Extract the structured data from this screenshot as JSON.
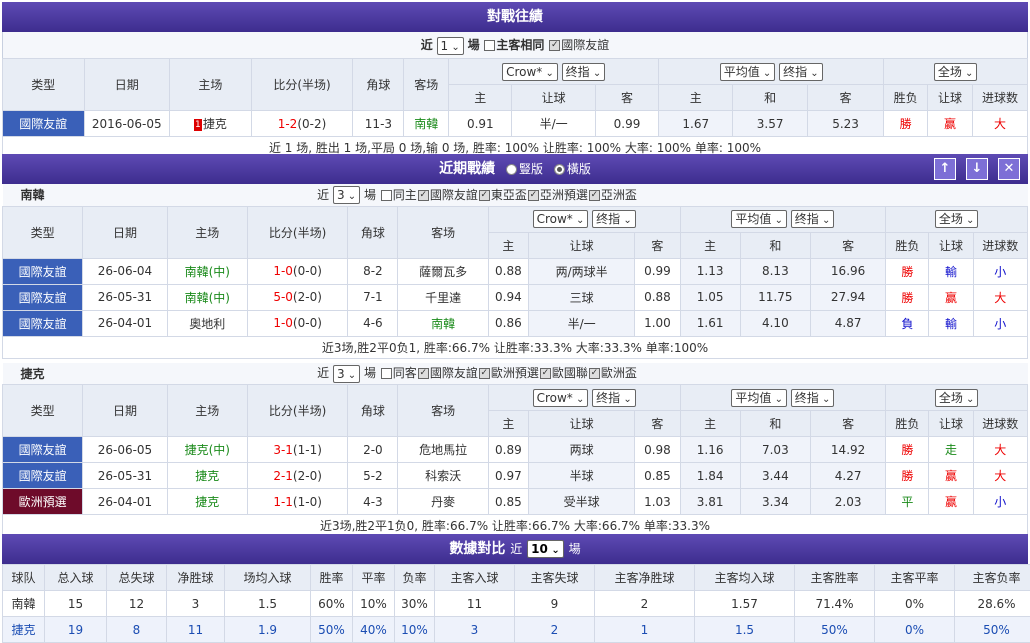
{
  "h2h": {
    "title": "對戰往績",
    "ctrl": {
      "recent": "近",
      "count": "1",
      "unit": "場",
      "same": "主客相同",
      "intl": "國際友誼"
    },
    "headers": {
      "type": "类型",
      "date": "日期",
      "home": "主场",
      "score": "比分(半场)",
      "corner": "角球",
      "away": "客场",
      "company": "Crow*",
      "handicap_sel": "终指",
      "odds_sel": "平均值",
      "odds_sel2": "终指",
      "full_sel": "全场",
      "home_h": "主",
      "line": "让球",
      "away_h": "客",
      "home_o": "主",
      "draw": "和",
      "away_o": "客",
      "result": "胜负",
      "hcres": "让球",
      "goals": "进球数"
    },
    "rows": [
      {
        "type": "國際友誼",
        "date": "2016-06-05",
        "home": "捷克",
        "home_rank": "1",
        "score": "1-2",
        "half": "(0-2)",
        "corner": "11-3",
        "away": "南韓",
        "h1": "0.91",
        "line": "半/一",
        "h2": "0.99",
        "o1": "1.67",
        "o2": "3.57",
        "o3": "5.23",
        "res": "勝",
        "hc": "赢",
        "g": "大"
      }
    ],
    "summary": "近 1 场, 胜出 1 场,平局 0 场,输 0 场, 胜率: 100% 让胜率: 100% 大率: 100% 单率: 100%"
  },
  "recent": {
    "title": "近期戰績",
    "opt1": "豎版",
    "opt2": "橫版",
    "up": "↑",
    "down": "↓",
    "close": "✕",
    "teamA": {
      "name": "南韓",
      "count": "3",
      "filters": [
        "同主",
        "國際友誼",
        "東亞盃",
        "亞洲預選",
        "亞洲盃"
      ],
      "rows": [
        {
          "type": "國際友誼",
          "date": "26-06-04",
          "home": "南韓(中)",
          "score": "1-0",
          "half": "(0-0)",
          "corner": "8-2",
          "away": "薩爾瓦多",
          "h1": "0.88",
          "line": "两/两球半",
          "h2": "0.99",
          "o1": "1.13",
          "o2": "8.13",
          "o3": "16.96",
          "res": "勝",
          "hc": "輸",
          "g": "小"
        },
        {
          "type": "國際友誼",
          "date": "26-05-31",
          "home": "南韓(中)",
          "score": "5-0",
          "half": "(2-0)",
          "corner": "7-1",
          "away": "千里達",
          "h1": "0.94",
          "line": "三球",
          "h2": "0.88",
          "o1": "1.05",
          "o2": "11.75",
          "o3": "27.94",
          "res": "勝",
          "hc": "赢",
          "g": "大"
        },
        {
          "type": "國際友誼",
          "date": "26-04-01",
          "home": "奧地利",
          "score": "1-0",
          "half": "(0-0)",
          "corner": "4-6",
          "away": "南韓",
          "h1": "0.86",
          "line": "半/一",
          "h2": "1.00",
          "o1": "1.61",
          "o2": "4.10",
          "o3": "4.87",
          "res": "負",
          "hc": "輸",
          "g": "小"
        }
      ],
      "summary": "近3场,胜2平0负1, 胜率:66.7% 让胜率:33.3% 大率:33.3% 单率:100%"
    },
    "teamB": {
      "name": "捷克",
      "count": "3",
      "filters": [
        "同客",
        "國際友誼",
        "歐洲預選",
        "歐國聯",
        "歐洲盃"
      ],
      "rows": [
        {
          "type": "國際友誼",
          "date": "26-06-05",
          "home": "捷克(中)",
          "score": "3-1",
          "half": "(1-1)",
          "corner": "2-0",
          "away": "危地馬拉",
          "h1": "0.89",
          "line": "两球",
          "h2": "0.98",
          "o1": "1.16",
          "o2": "7.03",
          "o3": "14.92",
          "res": "勝",
          "hc": "走",
          "g": "大"
        },
        {
          "type": "國際友誼",
          "date": "26-05-31",
          "home": "捷克",
          "score": "2-1",
          "half": "(2-0)",
          "corner": "5-2",
          "away": "科索沃",
          "h1": "0.97",
          "line": "半球",
          "h2": "0.85",
          "o1": "1.84",
          "o2": "3.44",
          "o3": "4.27",
          "res": "勝",
          "hc": "赢",
          "g": "大"
        },
        {
          "type": "歐洲預選",
          "date": "26-04-01",
          "home": "捷克",
          "score": "1-1",
          "half": "(1-0)",
          "corner": "4-3",
          "away": "丹麥",
          "h1": "0.85",
          "line": "受半球",
          "h2": "1.03",
          "o1": "3.81",
          "o2": "3.34",
          "o3": "2.03",
          "res": "平",
          "hc": "赢",
          "g": "小"
        }
      ],
      "summary": "近3场,胜2平1负0, 胜率:66.7% 让胜率:66.7% 大率:66.7% 单率:33.3%"
    }
  },
  "stats": {
    "title": "數據對比",
    "recent": "近",
    "count": "10",
    "unit": "場",
    "headers": [
      "球队",
      "总入球",
      "总失球",
      "净胜球",
      "场均入球",
      "胜率",
      "平率",
      "负率",
      "主客入球",
      "主客失球",
      "主客净胜球",
      "主客均入球",
      "主客胜率",
      "主客平率",
      "主客负率"
    ],
    "rows": [
      [
        "南韓",
        "15",
        "12",
        "3",
        "1.5",
        "60%",
        "10%",
        "30%",
        "11",
        "9",
        "2",
        "1.57",
        "71.4%",
        "0%",
        "28.6%"
      ],
      [
        "捷克",
        "19",
        "8",
        "11",
        "1.9",
        "50%",
        "40%",
        "10%",
        "3",
        "2",
        "1",
        "1.5",
        "50%",
        "0%",
        "50%"
      ]
    ]
  },
  "colors": {
    "header": "#4a3aa0",
    "type_friendly": "#3a60b8",
    "type_euro": "#6e0b2a",
    "win": "#e00",
    "lose": "#11c",
    "draw": "#1a8a1a"
  }
}
